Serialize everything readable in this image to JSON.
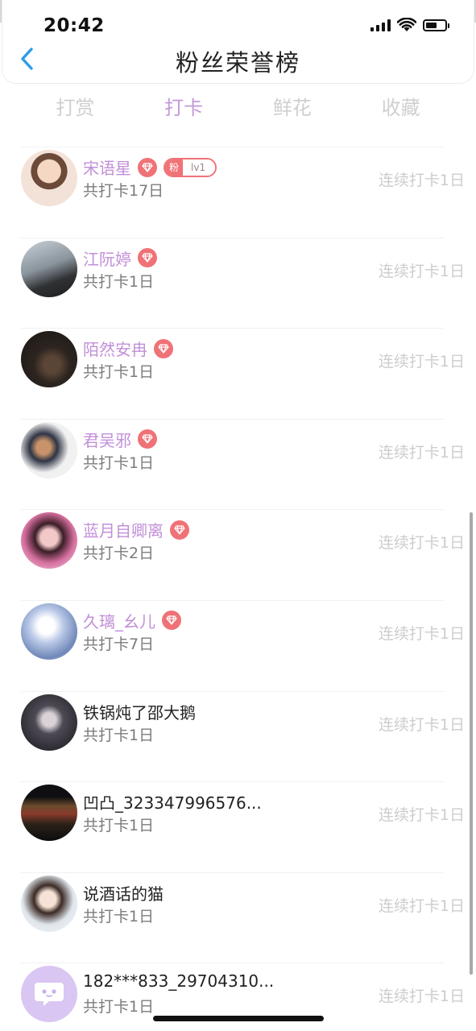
{
  "status_bar": {
    "time": "20:42",
    "battery_level": 0.6
  },
  "header": {
    "title": "粉丝荣誉榜"
  },
  "tabs": [
    {
      "label": "打赏",
      "active": false
    },
    {
      "label": "打卡",
      "active": true
    },
    {
      "label": "鲜花",
      "active": false
    },
    {
      "label": "收藏",
      "active": false
    }
  ],
  "fans": [
    {
      "name": "宋语星",
      "name_color": "purple",
      "vip": true,
      "fan_badge": {
        "label": "粉",
        "level": "lv1"
      },
      "total": "共打卡17日",
      "streak": "连续打卡1日",
      "avatar": "avatar-photo"
    },
    {
      "name": "江阮婷",
      "name_color": "purple",
      "vip": true,
      "total": "共打卡1日",
      "streak": "连续打卡1日",
      "avatar": "avatar-photo"
    },
    {
      "name": "陌然安冉",
      "name_color": "purple",
      "vip": true,
      "total": "共打卡1日",
      "streak": "连续打卡1日",
      "avatar": "avatar-photo"
    },
    {
      "name": "君吴邪",
      "name_color": "purple",
      "vip": true,
      "total": "共打卡1日",
      "streak": "连续打卡1日",
      "avatar": "avatar-photo"
    },
    {
      "name": "蓝月自卿离",
      "name_color": "purple",
      "vip": true,
      "total": "共打卡2日",
      "streak": "连续打卡1日",
      "avatar": "avatar-photo"
    },
    {
      "name": "久璃_幺儿",
      "name_color": "purple",
      "vip": true,
      "total": "共打卡7日",
      "streak": "连续打卡1日",
      "avatar": "avatar-photo"
    },
    {
      "name": "铁锅炖了邵大鹅",
      "name_color": "black",
      "vip": false,
      "total": "共打卡1日",
      "streak": "连续打卡1日",
      "avatar": "avatar-photo"
    },
    {
      "name": "凹凸_323347996576...",
      "name_color": "black",
      "vip": false,
      "total": "共打卡1日",
      "streak": "连续打卡1日",
      "avatar": "avatar-photo"
    },
    {
      "name": "说酒话的猫",
      "name_color": "black",
      "vip": false,
      "total": "共打卡1日",
      "streak": "连续打卡1日",
      "avatar": "avatar-photo"
    },
    {
      "name": "182***833_29704310...",
      "name_color": "black",
      "vip": false,
      "total": "共打卡1日",
      "streak": "连续打卡1日",
      "avatar": "avatar-default-chat-icon"
    }
  ],
  "colors": {
    "accent_purple": "#c49ad9",
    "vip_badge": "#ef7277",
    "back_arrow": "#2b9de8"
  }
}
